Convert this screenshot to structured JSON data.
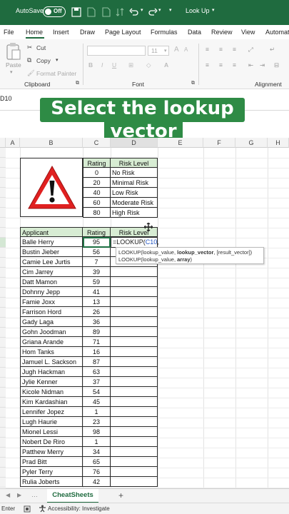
{
  "titlebar": {
    "autosave_label": "AutoSave",
    "autosave_state": "Off",
    "doc_title": "Look Up",
    "accent": "#1f6b3f"
  },
  "menu": {
    "tabs": [
      "File",
      "Home",
      "Insert",
      "Draw",
      "Page Layout",
      "Formulas",
      "Data",
      "Review",
      "View",
      "Automat"
    ],
    "active": "Home"
  },
  "ribbon": {
    "paste": "Paste",
    "cut": "Cut",
    "copy": "Copy",
    "format_painter": "Format Painter",
    "font_size": "11",
    "groups": {
      "clipboard": "Clipboard",
      "font": "Font",
      "alignment": "Alignment"
    }
  },
  "namebox": "D10",
  "banner": {
    "line1": "Select the lookup",
    "line2": "vector"
  },
  "columns": [
    "A",
    "B",
    "C",
    "D",
    "E",
    "F",
    "G",
    "H"
  ],
  "risk_table": {
    "headers": [
      "Rating",
      "Risk Level"
    ],
    "rows": [
      [
        "0",
        "No Risk"
      ],
      [
        "20",
        "Minimal Risk"
      ],
      [
        "40",
        "Low Risk"
      ],
      [
        "60",
        "Moderate Risk"
      ],
      [
        "80",
        "High Risk"
      ]
    ]
  },
  "applicants": {
    "headers": [
      "Applicant",
      "Rating",
      "Risk Level"
    ],
    "rows": [
      [
        "Balle Herry",
        "95"
      ],
      [
        "Bustin Jieber",
        "56"
      ],
      [
        "Camie Lee Jurtis",
        "7"
      ],
      [
        "Cim Jarrey",
        "39"
      ],
      [
        "Datt Mamon",
        "59"
      ],
      [
        "Dohnny Jepp",
        "41"
      ],
      [
        "Famie Joxx",
        "13"
      ],
      [
        "Farrison Hord",
        "26"
      ],
      [
        "Gady Laga",
        "36"
      ],
      [
        "Gohn Joodman",
        "89"
      ],
      [
        "Griana Arande",
        "71"
      ],
      [
        "Hom Tanks",
        "16"
      ],
      [
        "Jamuel L. Sackson",
        "87"
      ],
      [
        "Jugh Hackman",
        "63"
      ],
      [
        "Jylie Kenner",
        "37"
      ],
      [
        "Kicole Nidman",
        "54"
      ],
      [
        "Kim Kardashian",
        "45"
      ],
      [
        "Lennifer Jopez",
        "1"
      ],
      [
        "Lugh Haurie",
        "23"
      ],
      [
        "Mionel Lessi",
        "98"
      ],
      [
        "Nobert De Riro",
        "1"
      ],
      [
        "Patthew Merry",
        "34"
      ],
      [
        "Prad Bitt",
        "65"
      ],
      [
        "Pyler Terry",
        "76"
      ],
      [
        "Rulia Joberts",
        "42"
      ]
    ]
  },
  "formula": {
    "prefix": "=LOOKUP(",
    "ref": "C10",
    "suffix": ","
  },
  "tooltip": {
    "line1_a": "LOOKUP(lookup_value, ",
    "line1_b": "lookup_vector",
    "line1_c": ", [result_vector])",
    "line2_a": "LOOKUP(lookup_value, ",
    "line2_b": "array",
    "line2_c": ")"
  },
  "sheet": {
    "tab": "CheatSheets",
    "add": "+"
  },
  "status": {
    "mode": "Enter",
    "accessibility": "Accessibility: Investigate"
  }
}
